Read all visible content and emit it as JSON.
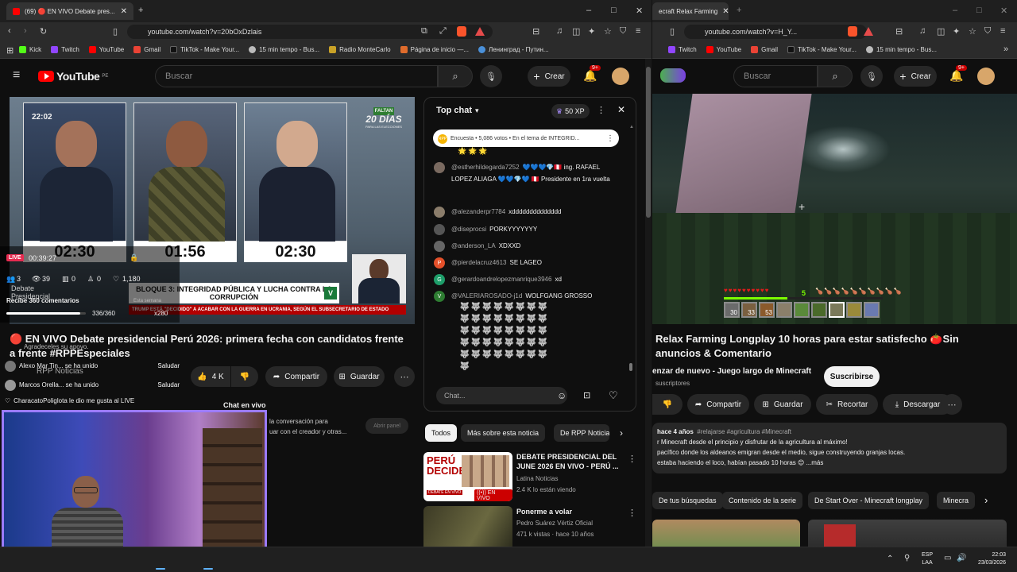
{
  "left_window": {
    "tabs": [
      {
        "label": "(69) 🔴 EN VIVO Debate pres..."
      }
    ],
    "url": "youtube.com/watch?v=20bOxDzlais",
    "bookmarks": [
      "Kick",
      "Twitch",
      "YouTube",
      "Gmail",
      "TikTok - Make Your...",
      "15 min tempo - Bus...",
      "Radio MonteCarlo",
      "Página de inicio —...",
      "Ленинград - Путин..."
    ],
    "search_placeholder": "Buscar",
    "create_label": "Crear",
    "notif_badge": "9+",
    "logo_text": "YouTube",
    "logo_sup": "PE",
    "video": {
      "clock": "22:02",
      "timers": [
        "02:30",
        "01:56",
        "02:30"
      ],
      "countdown_top": "FALTAN",
      "countdown_num": "20 DÍAS",
      "countdown_sub": "PARA LAS ELECCIONES",
      "lower_third_main": "BLOQUE 3: INTEGRIDAD PÚBLICA Y LUCHA CONTRA LA CORRUPCIÓN",
      "ticker": "TRUMP ESTÁ \"DECIDIDO\" A ACABAR CON LA GUERRA EN UCRANIA, SEGÚN EL SUBSECRETARIO DE ESTADO",
      "live_badge": "LIVE",
      "live_time": "00:39:27",
      "stats": [
        "3",
        "39",
        "0",
        "0",
        "1,180"
      ],
      "debate_label": "Debate Presidencial",
      "semana_label": "Esta semana",
      "progress_text": "Recibe 360 comentarios",
      "progress_count": "336/360",
      "progress_value": 0.93,
      "coin_count": "x280"
    },
    "title": "🔴 EN VIVO Debate presidencial Perú 2026: primera fecha con candidatos frente a frente #RPPEspeciales",
    "channel": "RPP Noticias",
    "likes": "4 K",
    "share_label": "Compartir",
    "save_label": "Guardar",
    "chat_tab": "Chat en vivo",
    "chat_prompt": "la conversación para\nuar con el creador y otras...",
    "open_panel": "Abrir panel",
    "overlay_msgs": [
      {
        "text": "Alexo Mar Tin... se ha unido",
        "action": "Saludar"
      },
      {
        "text": "Marcos Orella... se ha unido",
        "action": "Saludar"
      },
      {
        "text": "CharacatoPoliglota  le dio me gusta al LIVE",
        "action": ""
      }
    ],
    "overlay_thanks": "Agradeceles su apoyo.",
    "chat": {
      "header": "Top chat",
      "xp": "50 XP",
      "poll": "Encuesta • 5,086 votos • En el tema de INTEGRID...",
      "messages": [
        {
          "user": "@estherhildegarda7252",
          "text": "💙💙💙💎🇵🇪 ing. RAFAEL LOPEZ ALIAGA 💙💙💎💙 🇵🇪 Presidente en 1ra vuelta",
          "color": "#7a6a60",
          "initial": ""
        },
        {
          "user": "@alezanderpr7784",
          "text": "xdddddddddddddd",
          "color": "#8b7d6b",
          "initial": ""
        },
        {
          "user": "@diseprocsi",
          "text": "PORKYYYYYYY",
          "color": "#555",
          "initial": ""
        },
        {
          "user": "@anderson_LA",
          "text": "XDXXD",
          "color": "#666",
          "initial": ""
        },
        {
          "user": "@pierdelacruz4613",
          "text": "SE LAGEO",
          "color": "#e4502a",
          "initial": "P"
        },
        {
          "user": "@gerardoandrelopezmanrique3946",
          "text": "xd",
          "color": "#1e9e6a",
          "initial": "G"
        },
        {
          "user": "@VALERIAROSADO-j1d",
          "text": "WOLFGANG GROSSO",
          "color": "#2e7d32",
          "initial": "V"
        }
      ],
      "input_placeholder": "Chat..."
    },
    "chips": [
      "Todos",
      "Más sobre esta noticia",
      "De RPP Noticias"
    ],
    "related": [
      {
        "title": "DEBATE PRESIDENCIAL DEL JUNE 2026 EN VIVO - PERÚ ...",
        "channel": "Latina Noticias",
        "meta": "2.4 K lo están viendo",
        "thumb_text": "PERÚ DECIDE",
        "thumb_sub": "DEBATE EN VIVO",
        "badge": "EN VIVO"
      },
      {
        "title": "Ponerme a volar",
        "channel": "Pedro Suárez Vértiz Oficial",
        "meta": "471 k vistas · hace 10 años",
        "thumb_text": "",
        "thumb_sub": "",
        "badge": ""
      }
    ]
  },
  "right_window": {
    "tab": "ecraft Relax Farming",
    "url": "youtube.com/watch?v=H_Y...",
    "bookmarks": [
      "Twitch",
      "YouTube",
      "Gmail",
      "TikTok - Make Your...",
      "15 min tempo - Bus..."
    ],
    "search_placeholder": "Buscar",
    "create_label": "Crear",
    "notif_badge": "9+",
    "level": "5",
    "hotbar": [
      "30",
      "33",
      "53",
      "",
      "",
      "",
      "",
      "",
      ""
    ],
    "title": "Relax Farming Longplay 10 horas para estar satisfecho 🍅Sin anuncios & Comentario",
    "channel_line": "enzar de nuevo - Juego largo de Minecraft",
    "subs": "suscriptores",
    "subscribe": "Suscribirse",
    "actions": [
      "Compartir",
      "Guardar",
      "Recortar",
      "Descargar"
    ],
    "desc_meta": "hace 4 años",
    "desc_tags": "#relajarse #agricultura #Minecraft",
    "desc_lines": [
      "r Minecraft desde el principio y disfrutar de la agricultura al máximo!",
      "pacífico donde los aldeanos emigran desde el medio, sigue construyendo granjas locas.",
      "estaba haciendo el loco, habían pasado 10 horas 😊 ...más"
    ],
    "chips": [
      "De tus búsquedas",
      "Contenido de la serie",
      "De Start Over - Minecraft longplay",
      "Minecra"
    ]
  },
  "taskbar": {
    "lang_top": "ESP",
    "lang_bottom": "LAA",
    "time": "22:03",
    "date": "23/03/2026"
  },
  "colors": {
    "youtube_red": "#ff0000",
    "live_red": "#cc0000",
    "accent_purple": "#7b3fe4",
    "chat_bg": "#0f0f0f"
  }
}
